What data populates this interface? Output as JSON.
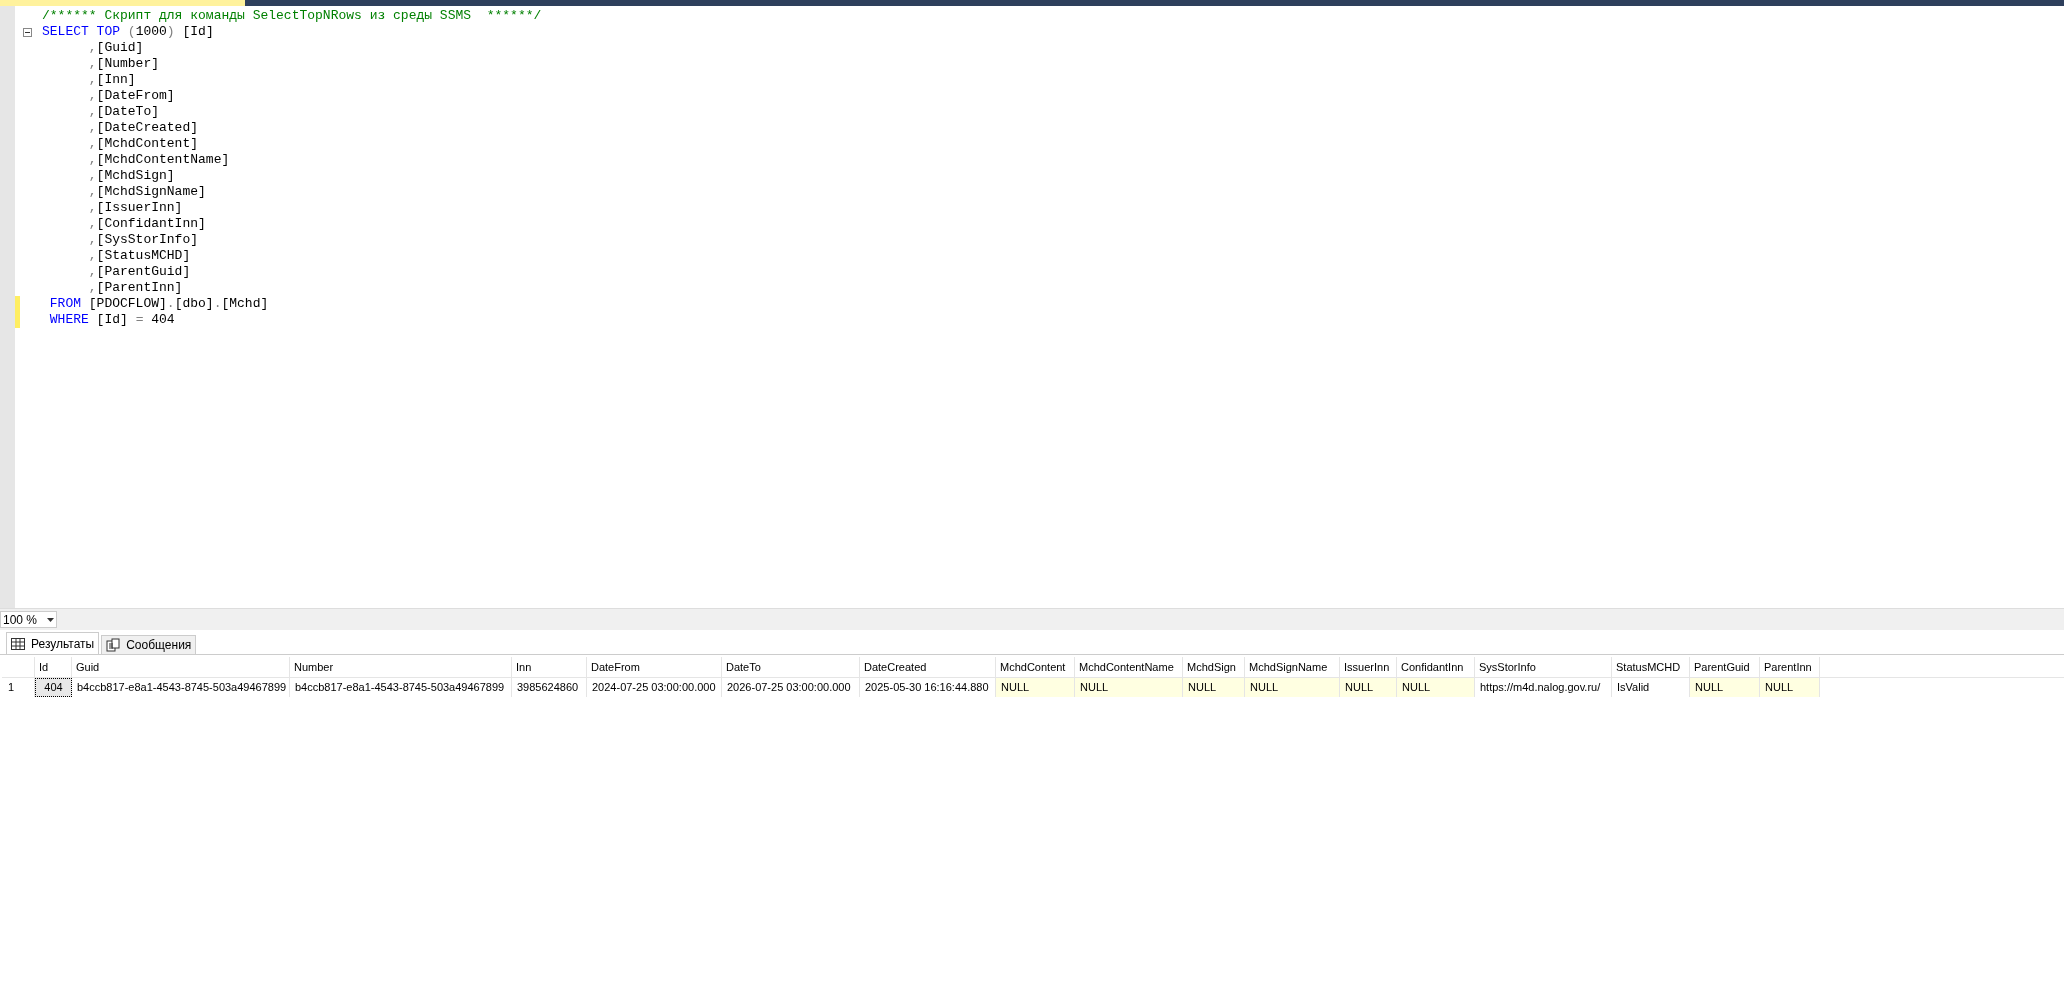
{
  "editor": {
    "lines": [
      {
        "changed": false,
        "fold": false,
        "segments": [
          {
            "kind": "comment",
            "text": "/****** Скрипт для команды SelectTopNRows из среды SSMS  ******/"
          }
        ]
      },
      {
        "changed": false,
        "fold": true,
        "segments": [
          {
            "kind": "keyword",
            "text": "SELECT TOP "
          },
          {
            "kind": "punct",
            "text": "("
          },
          {
            "kind": "plain",
            "text": "1000"
          },
          {
            "kind": "punct",
            "text": ")"
          },
          {
            "kind": "plain",
            "text": " [Id]"
          }
        ]
      },
      {
        "changed": false,
        "fold": false,
        "segments": [
          {
            "kind": "punct",
            "text": "      ,"
          },
          {
            "kind": "plain",
            "text": "[Guid]"
          }
        ]
      },
      {
        "changed": false,
        "fold": false,
        "segments": [
          {
            "kind": "punct",
            "text": "      ,"
          },
          {
            "kind": "plain",
            "text": "[Number]"
          }
        ]
      },
      {
        "changed": false,
        "fold": false,
        "segments": [
          {
            "kind": "punct",
            "text": "      ,"
          },
          {
            "kind": "plain",
            "text": "[Inn]"
          }
        ]
      },
      {
        "changed": false,
        "fold": false,
        "segments": [
          {
            "kind": "punct",
            "text": "      ,"
          },
          {
            "kind": "plain",
            "text": "[DateFrom]"
          }
        ]
      },
      {
        "changed": false,
        "fold": false,
        "segments": [
          {
            "kind": "punct",
            "text": "      ,"
          },
          {
            "kind": "plain",
            "text": "[DateTo]"
          }
        ]
      },
      {
        "changed": false,
        "fold": false,
        "segments": [
          {
            "kind": "punct",
            "text": "      ,"
          },
          {
            "kind": "plain",
            "text": "[DateCreated]"
          }
        ]
      },
      {
        "changed": false,
        "fold": false,
        "segments": [
          {
            "kind": "punct",
            "text": "      ,"
          },
          {
            "kind": "plain",
            "text": "[MchdContent]"
          }
        ]
      },
      {
        "changed": false,
        "fold": false,
        "segments": [
          {
            "kind": "punct",
            "text": "      ,"
          },
          {
            "kind": "plain",
            "text": "[MchdContentName]"
          }
        ]
      },
      {
        "changed": false,
        "fold": false,
        "segments": [
          {
            "kind": "punct",
            "text": "      ,"
          },
          {
            "kind": "plain",
            "text": "[MchdSign]"
          }
        ]
      },
      {
        "changed": false,
        "fold": false,
        "segments": [
          {
            "kind": "punct",
            "text": "      ,"
          },
          {
            "kind": "plain",
            "text": "[MchdSignName]"
          }
        ]
      },
      {
        "changed": false,
        "fold": false,
        "segments": [
          {
            "kind": "punct",
            "text": "      ,"
          },
          {
            "kind": "plain",
            "text": "[IssuerInn]"
          }
        ]
      },
      {
        "changed": false,
        "fold": false,
        "segments": [
          {
            "kind": "punct",
            "text": "      ,"
          },
          {
            "kind": "plain",
            "text": "[ConfidantInn]"
          }
        ]
      },
      {
        "changed": false,
        "fold": false,
        "segments": [
          {
            "kind": "punct",
            "text": "      ,"
          },
          {
            "kind": "plain",
            "text": "[SysStorInfo]"
          }
        ]
      },
      {
        "changed": false,
        "fold": false,
        "segments": [
          {
            "kind": "punct",
            "text": "      ,"
          },
          {
            "kind": "plain",
            "text": "[StatusMCHD]"
          }
        ]
      },
      {
        "changed": false,
        "fold": false,
        "segments": [
          {
            "kind": "punct",
            "text": "      ,"
          },
          {
            "kind": "plain",
            "text": "[ParentGuid]"
          }
        ]
      },
      {
        "changed": false,
        "fold": false,
        "segments": [
          {
            "kind": "punct",
            "text": "      ,"
          },
          {
            "kind": "plain",
            "text": "[ParentInn]"
          }
        ]
      },
      {
        "changed": true,
        "fold": false,
        "segments": [
          {
            "kind": "keyword",
            "text": " FROM "
          },
          {
            "kind": "plain",
            "text": "[PDOCFLOW]"
          },
          {
            "kind": "punct",
            "text": "."
          },
          {
            "kind": "plain",
            "text": "[dbo]"
          },
          {
            "kind": "punct",
            "text": "."
          },
          {
            "kind": "plain",
            "text": "[Mchd]"
          }
        ]
      },
      {
        "changed": true,
        "fold": false,
        "segments": [
          {
            "kind": "keyword",
            "text": " WHERE "
          },
          {
            "kind": "plain",
            "text": "[Id] "
          },
          {
            "kind": "punct",
            "text": "="
          },
          {
            "kind": "plain",
            "text": " 404"
          }
        ]
      }
    ]
  },
  "zoom": {
    "value": "100 %"
  },
  "result_tabs": [
    {
      "label": "Результаты",
      "selected": true,
      "kind": "grid"
    },
    {
      "label": "Сообщения",
      "selected": false,
      "kind": "messages"
    }
  ],
  "grid": {
    "columns": [
      "Id",
      "Guid",
      "Number",
      "Inn",
      "DateFrom",
      "DateTo",
      "DateCreated",
      "MchdContent",
      "MchdContentName",
      "MchdSign",
      "MchdSignName",
      "IssuerInn",
      "ConfidantInn",
      "SysStorInfo",
      "StatusMCHD",
      "ParentGuid",
      "ParentInn"
    ],
    "rows": [
      {
        "number": "1",
        "cells": [
          {
            "text": "404",
            "is_null": false,
            "selected": true
          },
          {
            "text": "b4ccb817-e8a1-4543-8745-503a49467899",
            "is_null": false,
            "selected": false
          },
          {
            "text": "b4ccb817-e8a1-4543-8745-503a49467899",
            "is_null": false,
            "selected": false
          },
          {
            "text": "3985624860",
            "is_null": false,
            "selected": false
          },
          {
            "text": "2024-07-25 03:00:00.000",
            "is_null": false,
            "selected": false
          },
          {
            "text": "2026-07-25 03:00:00.000",
            "is_null": false,
            "selected": false
          },
          {
            "text": "2025-05-30 16:16:44.880",
            "is_null": false,
            "selected": false
          },
          {
            "text": "NULL",
            "is_null": true,
            "selected": false
          },
          {
            "text": "NULL",
            "is_null": true,
            "selected": false
          },
          {
            "text": "NULL",
            "is_null": true,
            "selected": false
          },
          {
            "text": "NULL",
            "is_null": true,
            "selected": false
          },
          {
            "text": "NULL",
            "is_null": true,
            "selected": false
          },
          {
            "text": "NULL",
            "is_null": true,
            "selected": false
          },
          {
            "text": "https://m4d.nalog.gov.ru/",
            "is_null": false,
            "selected": false
          },
          {
            "text": "IsValid",
            "is_null": false,
            "selected": false
          },
          {
            "text": "NULL",
            "is_null": true,
            "selected": false
          },
          {
            "text": "NULL",
            "is_null": true,
            "selected": false
          }
        ]
      }
    ]
  }
}
